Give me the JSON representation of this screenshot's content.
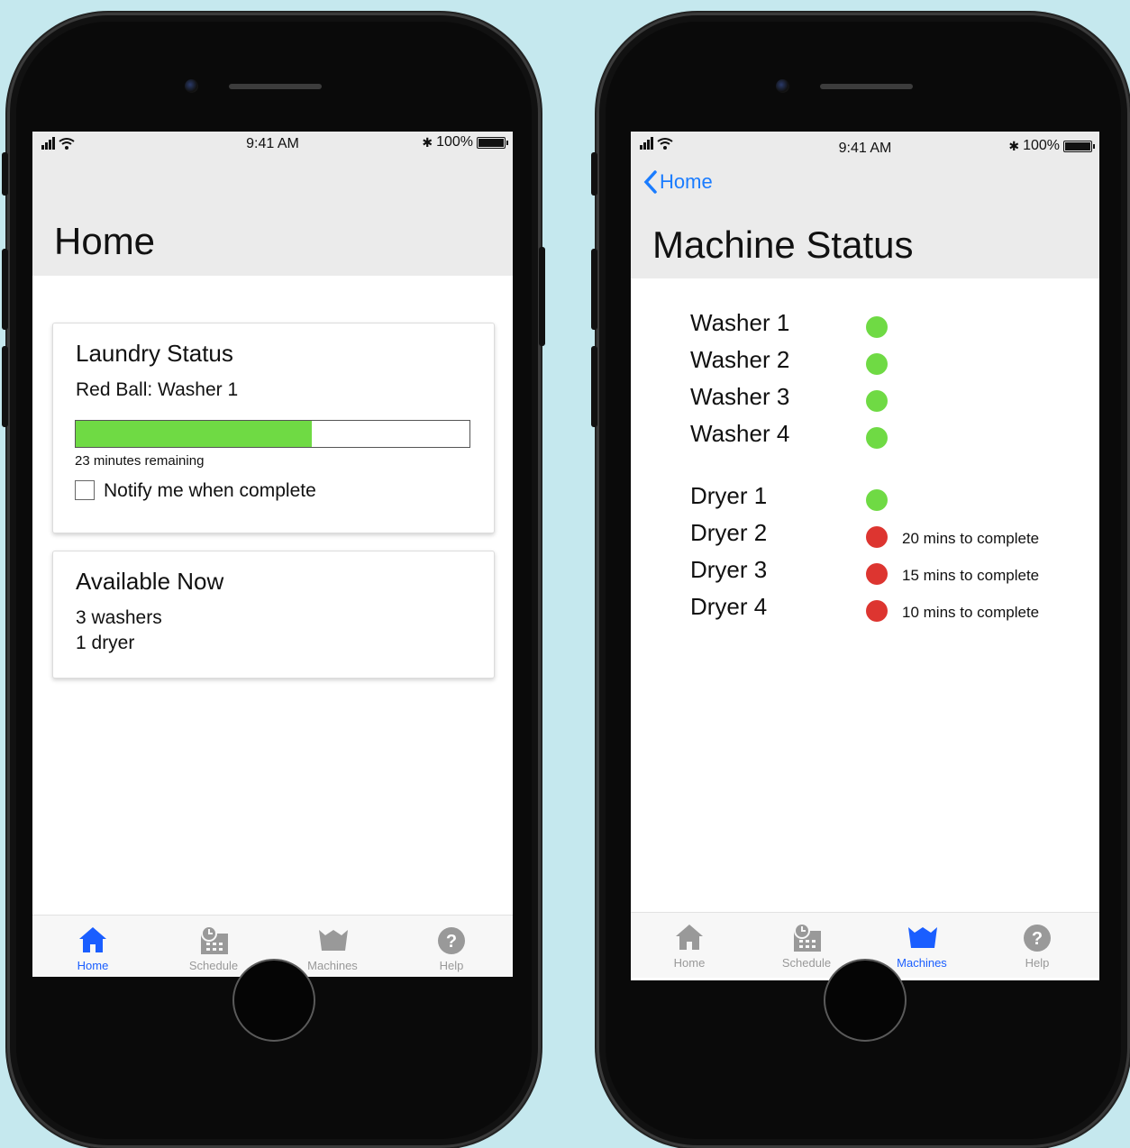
{
  "colors": {
    "background": "#c5e8ee",
    "accent": "#1a5eff",
    "progress": "#6fda44",
    "available": "#6fda44",
    "busy": "#dd3530",
    "inactive_tab": "#999999"
  },
  "status_bar": {
    "time": "9:41 AM",
    "battery": "100%",
    "signal_icon": "signal-bars-icon",
    "wifi_icon": "wifi-icon",
    "bluetooth_icon": "bluetooth-icon"
  },
  "home_screen": {
    "title": "Home",
    "laundry_card": {
      "title": "Laundry Status",
      "machine": "Red Ball: Washer 1",
      "progress": 0.6,
      "remaining": "23 minutes remaining",
      "notify_label": "Notify me when complete",
      "notify_checked": false
    },
    "available_card": {
      "title": "Available Now",
      "washers": "3 washers",
      "dryers": "1 dryer"
    },
    "active_tab": "Home"
  },
  "machine_screen": {
    "back_label": "Home",
    "title": "Machine Status",
    "washers": [
      {
        "name": "Washer 1",
        "status": "available"
      },
      {
        "name": "Washer 2",
        "status": "available"
      },
      {
        "name": "Washer 3",
        "status": "available"
      },
      {
        "name": "Washer 4",
        "status": "available"
      }
    ],
    "dryers": [
      {
        "name": "Dryer 1",
        "status": "available",
        "note": ""
      },
      {
        "name": "Dryer 2",
        "status": "busy",
        "note": "20 mins to complete"
      },
      {
        "name": "Dryer 3",
        "status": "busy",
        "note": "15 mins to complete"
      },
      {
        "name": "Dryer 4",
        "status": "busy",
        "note": "10 mins to complete"
      }
    ],
    "active_tab": "Machines"
  },
  "tabs": [
    {
      "label": "Home",
      "icon": "home-icon"
    },
    {
      "label": "Schedule",
      "icon": "calendar-clock-icon"
    },
    {
      "label": "Machines",
      "icon": "washing-tub-icon"
    },
    {
      "label": "Help",
      "icon": "help-icon"
    }
  ]
}
